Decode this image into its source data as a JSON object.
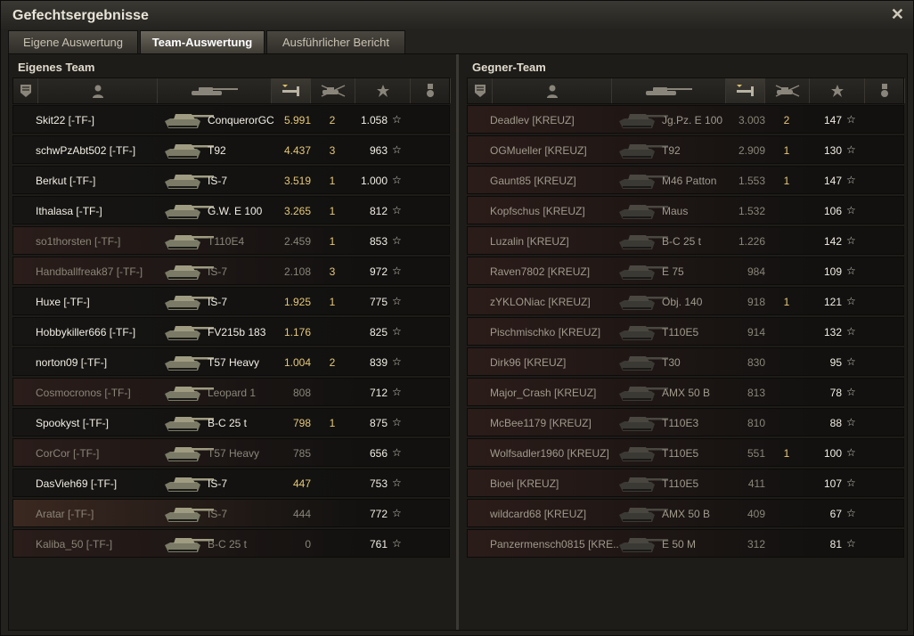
{
  "window": {
    "title": "Gefechtsergebnisse",
    "close_icon": "close-icon"
  },
  "tabs": [
    {
      "label": "Eigene Auswertung",
      "active": false
    },
    {
      "label": "Team-Auswertung",
      "active": true
    },
    {
      "label": "Ausführlicher Bericht",
      "active": false
    }
  ],
  "left": {
    "title": "Eigenes Team",
    "columns": [
      "rank-icon",
      "player-icon",
      "tank-icon",
      "damage-icon",
      "kills-icon",
      "xp-star-icon",
      "medal-icon"
    ],
    "sorted_column": "damage-icon",
    "rows": [
      {
        "player": "Skit22 [-TF-]",
        "tank": "ConquerorGC",
        "damage": "5.991",
        "kills": "2",
        "xp": "1.058",
        "dead": false
      },
      {
        "player": "schwPzAbt502 [-TF-]",
        "tank": "T92",
        "damage": "4.437",
        "kills": "3",
        "xp": "963",
        "dead": false
      },
      {
        "player": "Berkut [-TF-]",
        "tank": "IS-7",
        "damage": "3.519",
        "kills": "1",
        "xp": "1.000",
        "dead": false
      },
      {
        "player": "Ithalasa [-TF-]",
        "tank": "G.W. E 100",
        "damage": "3.265",
        "kills": "1",
        "xp": "812",
        "dead": false
      },
      {
        "player": "so1thorsten [-TF-]",
        "tank": "T110E4",
        "damage": "2.459",
        "kills": "1",
        "xp": "853",
        "dead": true
      },
      {
        "player": "Handballfreak87 [-TF-]",
        "tank": "IS-7",
        "damage": "2.108",
        "kills": "3",
        "xp": "972",
        "dead": true
      },
      {
        "player": "Huxe [-TF-]",
        "tank": "IS-7",
        "damage": "1.925",
        "kills": "1",
        "xp": "775",
        "dead": false
      },
      {
        "player": "Hobbykiller666 [-TF-]",
        "tank": "FV215b 183",
        "damage": "1.176",
        "kills": "",
        "xp": "825",
        "dead": false
      },
      {
        "player": "norton09 [-TF-]",
        "tank": "T57 Heavy",
        "damage": "1.004",
        "kills": "2",
        "xp": "839",
        "dead": false
      },
      {
        "player": "Cosmocronos [-TF-]",
        "tank": "Leopard 1",
        "damage": "808",
        "kills": "",
        "xp": "712",
        "dead": true
      },
      {
        "player": "Spookyst [-TF-]",
        "tank": "B-C 25 t",
        "damage": "798",
        "kills": "1",
        "xp": "875",
        "dead": false
      },
      {
        "player": "CorCor [-TF-]",
        "tank": "T57 Heavy",
        "damage": "785",
        "kills": "",
        "xp": "656",
        "dead": true
      },
      {
        "player": "DasVieh69 [-TF-]",
        "tank": "IS-7",
        "damage": "447",
        "kills": "",
        "xp": "753",
        "dead": false
      },
      {
        "player": "Aratar [-TF-]",
        "tank": "IS-7",
        "damage": "444",
        "kills": "",
        "xp": "772",
        "dead": true,
        "highlight": true
      },
      {
        "player": "Kaliba_50 [-TF-]",
        "tank": "B-C 25 t",
        "damage": "0",
        "kills": "",
        "xp": "761",
        "dead": true
      }
    ]
  },
  "right": {
    "title": "Gegner-Team",
    "columns": [
      "rank-icon",
      "player-icon",
      "tank-icon",
      "damage-icon",
      "kills-icon",
      "xp-star-icon",
      "medal-icon"
    ],
    "sorted_column": "damage-icon",
    "rows": [
      {
        "player": "Deadlev [KREUZ]",
        "tank": "Jg.Pz. E 100",
        "damage": "3.003",
        "kills": "2",
        "xp": "147",
        "dead": true
      },
      {
        "player": "OGMueller [KREUZ]",
        "tank": "T92",
        "damage": "2.909",
        "kills": "1",
        "xp": "130",
        "dead": true
      },
      {
        "player": "Gaunt85 [KREUZ]",
        "tank": "M46 Patton",
        "damage": "1.553",
        "kills": "1",
        "xp": "147",
        "dead": true
      },
      {
        "player": "Kopfschus [KREUZ]",
        "tank": "Maus",
        "damage": "1.532",
        "kills": "",
        "xp": "106",
        "dead": true
      },
      {
        "player": "Luzalin [KREUZ]",
        "tank": "B-C 25 t",
        "damage": "1.226",
        "kills": "",
        "xp": "142",
        "dead": true
      },
      {
        "player": "Raven7802 [KREUZ]",
        "tank": "E 75",
        "damage": "984",
        "kills": "",
        "xp": "109",
        "dead": true
      },
      {
        "player": "zYKLONiac [KREUZ]",
        "tank": "Obj. 140",
        "damage": "918",
        "kills": "1",
        "xp": "121",
        "dead": true
      },
      {
        "player": "Pischmischko [KREUZ]",
        "tank": "T110E5",
        "damage": "914",
        "kills": "",
        "xp": "132",
        "dead": true
      },
      {
        "player": "Dirk96 [KREUZ]",
        "tank": "T30",
        "damage": "830",
        "kills": "",
        "xp": "95",
        "dead": true
      },
      {
        "player": "Major_Crash [KREUZ]",
        "tank": "AMX 50 B",
        "damage": "813",
        "kills": "",
        "xp": "78",
        "dead": true
      },
      {
        "player": "McBee1179 [KREUZ]",
        "tank": "T110E3",
        "damage": "810",
        "kills": "",
        "xp": "88",
        "dead": true
      },
      {
        "player": "Wolfsadler1960 [KREUZ]",
        "tank": "T110E5",
        "damage": "551",
        "kills": "1",
        "xp": "100",
        "dead": true
      },
      {
        "player": "Bioei [KREUZ]",
        "tank": "T110E5",
        "damage": "411",
        "kills": "",
        "xp": "107",
        "dead": true
      },
      {
        "player": "wildcard68 [KREUZ]",
        "tank": "AMX 50 B",
        "damage": "409",
        "kills": "",
        "xp": "67",
        "dead": true
      },
      {
        "player": "Panzermensch0815 [KRE..",
        "tank": "E 50 M",
        "damage": "312",
        "kills": "",
        "xp": "81",
        "dead": true
      }
    ]
  },
  "colors": {
    "alive_name": "#f2eee4",
    "dead_name": "#8a8578",
    "enemy_name": "#a09a8c",
    "damage_alive": "#e6c877",
    "damage_dead": "#8a8578",
    "kills": "#e6c877",
    "row_alive": "#161513",
    "row_dead": "#2a1d1a",
    "row_enemy": "#2b1c19",
    "row_highlight": "#3a2820"
  }
}
